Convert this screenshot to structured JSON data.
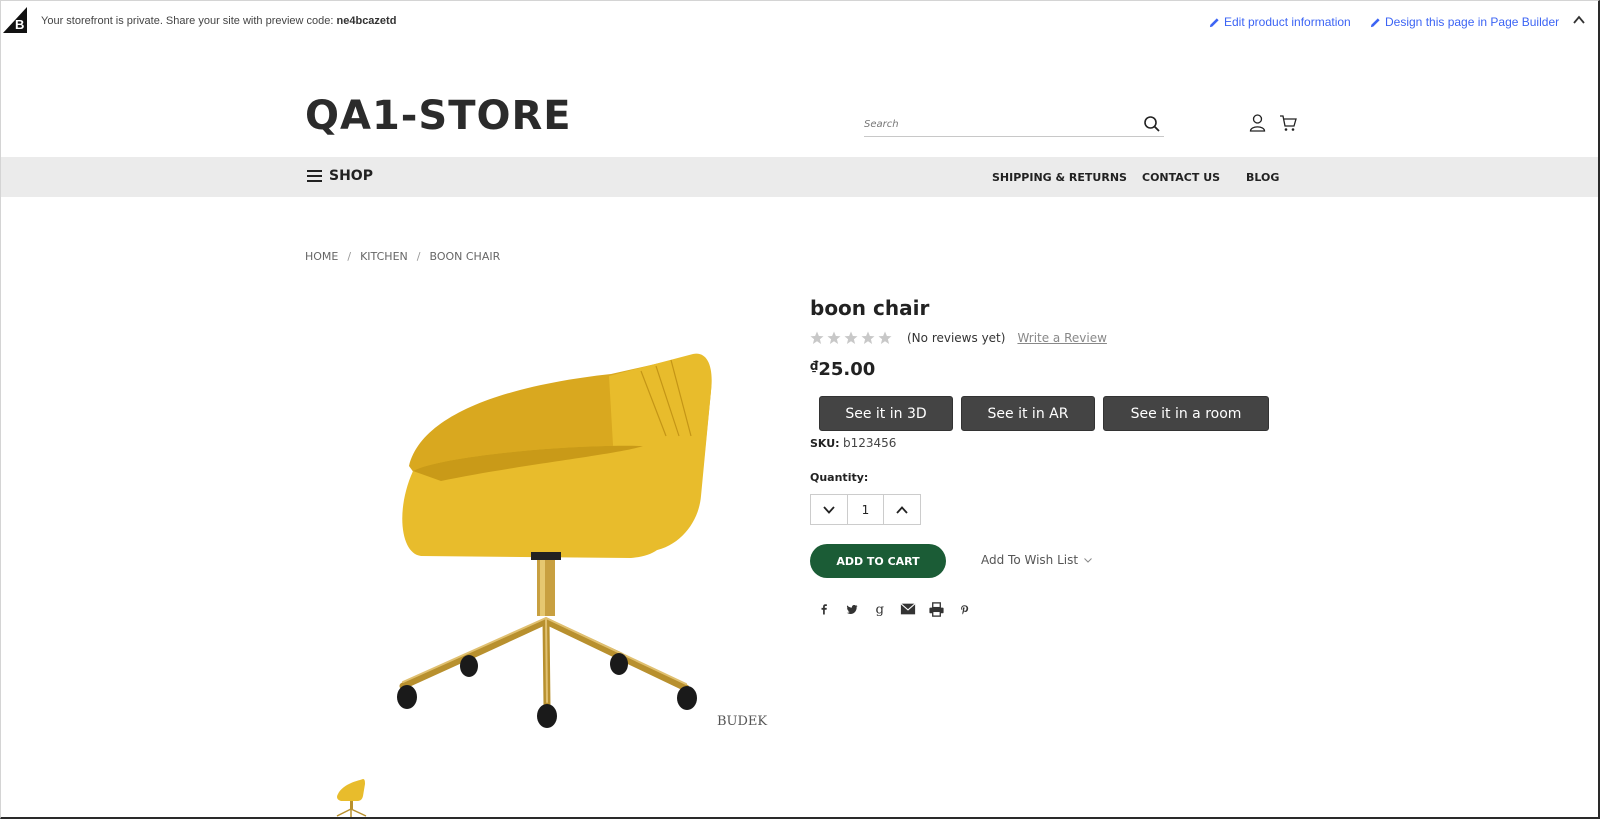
{
  "preview_bar": {
    "message": "Your storefront is private. Share your site with preview code: ",
    "preview_code": "ne4bcazetd",
    "edit_link": "Edit product information",
    "design_link": "Design this page in Page Builder",
    "accent_color": "#3c64f4",
    "icons": [
      "bigcommerce-logo-icon",
      "pencil-icon",
      "chevron-up-icon"
    ]
  },
  "header": {
    "store_name": "QA1-STORE",
    "search_placeholder": "Search",
    "icons": [
      "search-icon",
      "user-icon",
      "cart-icon"
    ]
  },
  "nav": {
    "shop_label": "SHOP",
    "links": [
      "SHIPPING & RETURNS",
      "CONTACT US",
      "BLOG"
    ]
  },
  "breadcrumb": [
    "HOME",
    "KITCHEN",
    "BOON CHAIR"
  ],
  "product": {
    "title": "boon chair",
    "rating_stars": 0,
    "rating_max": 5,
    "reviews_text": "(No reviews yet)",
    "write_review": "Write a Review",
    "price_symbol": "₫",
    "price_value": "25.00",
    "ar_buttons": [
      "See it in 3D",
      "See it in AR",
      "See it in a room"
    ],
    "sku_label": "SKU:",
    "sku_value": "b123456",
    "quantity_label": "Quantity:",
    "quantity_value": "1",
    "add_to_cart": "ADD TO CART",
    "wishlist": "Add To Wish List",
    "image_watermark": "BUDEK",
    "share_icons": [
      "facebook-icon",
      "twitter-icon",
      "google-icon",
      "email-icon",
      "print-icon",
      "pinterest-icon"
    ],
    "add_to_cart_color": "#1b5c36",
    "chair_color": "#e8bc2c"
  }
}
